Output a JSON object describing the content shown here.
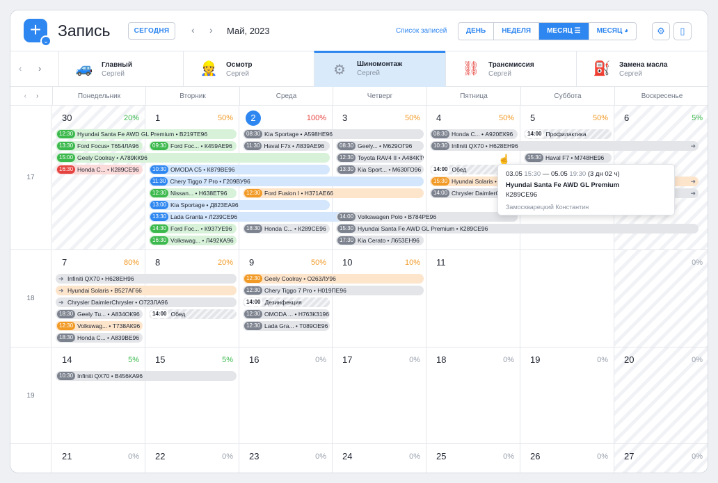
{
  "header": {
    "title": "Запись",
    "today_label": "СЕГОДНЯ",
    "period": "Май, 2023",
    "list_link": "Список записей",
    "views": [
      "ДЕНЬ",
      "НЕДЕЛЯ",
      "МЕСЯЦ",
      "МЕСЯЦ"
    ],
    "active_view": 2
  },
  "posts": [
    {
      "name": "Главный",
      "user": "Сергей",
      "icon": "car-icon"
    },
    {
      "name": "Осмотр",
      "user": "Сергей",
      "icon": "mechanic-icon"
    },
    {
      "name": "Шиномонтаж",
      "user": "Сергей",
      "icon": "wheel-icon",
      "active": true
    },
    {
      "name": "Трансмиссия",
      "user": "Сергей",
      "icon": "gearbox-icon"
    },
    {
      "name": "Замена масла",
      "user": "Сергей",
      "icon": "oil-can-icon"
    }
  ],
  "weekdays": [
    "Понедельник",
    "Вторник",
    "Среда",
    "Четверг",
    "Пятница",
    "Суббота",
    "Воскресенье"
  ],
  "weeks": [
    {
      "num": "17",
      "days": [
        {
          "d": "30",
          "p": "20%",
          "c": "#3cb94d",
          "hatch": true
        },
        {
          "d": "1",
          "p": "50%",
          "c": "#f19a26"
        },
        {
          "d": "2",
          "p": "100%",
          "c": "#e5433f",
          "today": true
        },
        {
          "d": "3",
          "p": "50%",
          "c": "#f19a26"
        },
        {
          "d": "4",
          "p": "50%",
          "c": "#f19a26"
        },
        {
          "d": "5",
          "p": "50%",
          "c": "#f19a26"
        },
        {
          "d": "6",
          "p": "5%",
          "c": "#3cb94d",
          "hatch": true
        }
      ]
    },
    {
      "num": "18",
      "days": [
        {
          "d": "7",
          "p": "80%",
          "c": "#f19a26"
        },
        {
          "d": "8",
          "p": "20%",
          "c": "#f19a26"
        },
        {
          "d": "9",
          "p": "50%",
          "c": "#f19a26"
        },
        {
          "d": "10",
          "p": "10%",
          "c": "#f19a26"
        },
        {
          "d": "11",
          "p": "",
          "c": "#9aa1ad"
        },
        {
          "d": "",
          "p": "",
          "c": "#9aa1ad"
        },
        {
          "d": "",
          "p": "0%",
          "c": "#9aa1ad",
          "hatch": true
        }
      ]
    },
    {
      "num": "19",
      "days": [
        {
          "d": "14",
          "p": "5%",
          "c": "#3cb94d"
        },
        {
          "d": "15",
          "p": "5%",
          "c": "#3cb94d"
        },
        {
          "d": "16",
          "p": "0%",
          "c": "#9aa1ad"
        },
        {
          "d": "17",
          "p": "0%",
          "c": "#9aa1ad"
        },
        {
          "d": "18",
          "p": "0%",
          "c": "#9aa1ad"
        },
        {
          "d": "19",
          "p": "0%",
          "c": "#9aa1ad"
        },
        {
          "d": "20",
          "p": "0%",
          "c": "#9aa1ad",
          "hatch": true
        }
      ]
    },
    {
      "num": "",
      "days": [
        {
          "d": "21",
          "p": "0%",
          "c": "#9aa1ad"
        },
        {
          "d": "22",
          "p": "0%",
          "c": "#9aa1ad"
        },
        {
          "d": "23",
          "p": "0%",
          "c": "#9aa1ad"
        },
        {
          "d": "24",
          "p": "0%",
          "c": "#9aa1ad"
        },
        {
          "d": "25",
          "p": "0%",
          "c": "#9aa1ad"
        },
        {
          "d": "26",
          "p": "0%",
          "c": "#9aa1ad"
        },
        {
          "d": "27",
          "p": "0%",
          "c": "#9aa1ad",
          "hatch": true
        }
      ]
    }
  ],
  "events": [
    {
      "w": 0,
      "s": 0,
      "e": 2,
      "r": 0,
      "t": "12:30",
      "x": "Hyundai Santa Fe AWD GL Premium • В219ТЕ96",
      "c": "green"
    },
    {
      "w": 0,
      "s": 0,
      "e": 1,
      "r": 1,
      "t": "13:30",
      "x": "Ford Focus• Т654ЛА96",
      "c": "green"
    },
    {
      "w": 0,
      "s": 0,
      "e": 3,
      "r": 2,
      "t": "15:00",
      "x": "Geely Coolray • А789КК96",
      "c": "green"
    },
    {
      "w": 0,
      "s": 0,
      "e": 1,
      "r": 3,
      "t": "16:30",
      "x": "Honda C... • К289СЕ96",
      "c": "red"
    },
    {
      "w": 0,
      "s": 1,
      "e": 2,
      "r": 1,
      "t": "09:30",
      "x": "Ford Foc... • К459АЕ96",
      "c": "green"
    },
    {
      "w": 0,
      "s": 1,
      "e": 3,
      "r": 3,
      "t": "10:30",
      "x": "OMODA C5 • К879ВЕ96",
      "c": "blue"
    },
    {
      "w": 0,
      "s": 1,
      "e": 4,
      "r": 4,
      "t": "11:30",
      "x": "Chery Tiggo 7 Pro • Г209ВУ96",
      "c": "blue"
    },
    {
      "w": 0,
      "s": 1,
      "e": 2,
      "r": 5,
      "t": "12:30",
      "x": "Nissan... • Н638ЕТ96",
      "c": "green"
    },
    {
      "w": 0,
      "s": 1,
      "e": 3,
      "r": 6,
      "t": "13:00",
      "x": "Kia Sportage • Д823ЕА96",
      "c": "blue"
    },
    {
      "w": 0,
      "s": 1,
      "e": 5,
      "r": 7,
      "t": "13:30",
      "x": "Lada Granta • Л239СЕ96",
      "c": "blue"
    },
    {
      "w": 0,
      "s": 1,
      "e": 2,
      "r": 8,
      "t": "14:30",
      "x": "Ford Foc... • К937УЕ96",
      "c": "green"
    },
    {
      "w": 0,
      "s": 1,
      "e": 2,
      "r": 9,
      "t": "16:30",
      "x": "Volkswag... • Л492КА96",
      "c": "green"
    },
    {
      "w": 0,
      "s": 2,
      "e": 4,
      "r": 0,
      "t": "08:30",
      "x": "Kia Sportage • А598НЕ96",
      "c": "gray"
    },
    {
      "w": 0,
      "s": 2,
      "e": 3,
      "r": 1,
      "t": "11:30",
      "x": "Haval F7x • Л839АЕ96",
      "c": "gray"
    },
    {
      "w": 0,
      "s": 2,
      "e": 4,
      "r": 5,
      "t": "12:30",
      "x": "Ford Fusion I • Н371АЕ66",
      "c": "orange"
    },
    {
      "w": 0,
      "s": 2,
      "e": 3,
      "r": 8,
      "t": "18:30",
      "x": "Honda C... • К289СЕ96",
      "c": "gray"
    },
    {
      "w": 0,
      "s": 3,
      "e": 4,
      "r": 1,
      "t": "08:30",
      "x": "Geely... • М629ОГ96",
      "c": "gray"
    },
    {
      "w": 0,
      "s": 3,
      "e": 4,
      "r": 2,
      "t": "12:30",
      "x": "Toyota RAV4 II • А484КТ96",
      "c": "gray"
    },
    {
      "w": 0,
      "s": 3,
      "e": 4,
      "r": 3,
      "t": "13:30",
      "x": "Kia Sport... • М630ГО96",
      "c": "gray"
    },
    {
      "w": 0,
      "s": 3,
      "e": 5,
      "r": 7,
      "t": "14:00",
      "x": "Volkswagen Polo • В784РЕ96",
      "c": "gray"
    },
    {
      "w": 0,
      "s": 3,
      "e": 7,
      "r": 8,
      "t": "15:30",
      "x": "Hyundai Santa Fe AWD GL Premium • К289СЕ96",
      "c": "gray"
    },
    {
      "w": 0,
      "s": 3,
      "e": 4,
      "r": 9,
      "t": "17:30",
      "x": "Kia Cerato • Л653ЕН96",
      "c": "gray"
    },
    {
      "w": 0,
      "s": 4,
      "e": 5,
      "r": 0,
      "t": "08:30",
      "x": "Honda C... • А920ЕК96",
      "c": "gray"
    },
    {
      "w": 0,
      "s": 4,
      "e": 7,
      "r": 1,
      "t": "10:30",
      "x": "Infiniti QX70 • Н628ЕН96",
      "c": "gray",
      "ra": "➜"
    },
    {
      "w": 0,
      "s": 4,
      "e": 5,
      "r": 3,
      "t": "14:00",
      "x": "Обед",
      "c": "gray",
      "hatch": true
    },
    {
      "w": 0,
      "s": 4,
      "e": 8,
      "r": 4,
      "t": "15:30",
      "x": "Hyundai Solaris • В527АГ66",
      "c": "orange",
      "ra": "➜"
    },
    {
      "w": 0,
      "s": 4,
      "e": 7,
      "r": 5,
      "t": "14:00",
      "x": "Chrysler DaimlerChrysler • О723ЛА96",
      "c": "gray",
      "ra": "➜"
    },
    {
      "w": 0,
      "s": 5,
      "e": 6,
      "r": 0,
      "t": "14:00",
      "x": "Профилактика",
      "c": "gray",
      "hatch": true
    },
    {
      "w": 0,
      "s": 5,
      "e": 6,
      "r": 2,
      "t": "15:30",
      "x": "Haval F7 • М748НЕ96",
      "c": "gray"
    },
    {
      "w": 1,
      "s": 0,
      "e": 2,
      "r": 0,
      "t": "",
      "a": "➜",
      "x": "Infiniti QX70 • Н628ЕН96",
      "c": "gray"
    },
    {
      "w": 1,
      "s": 0,
      "e": 2,
      "r": 1,
      "t": "",
      "a": "➜",
      "x": "Hyundai Solaris • В527АГ66",
      "c": "orange"
    },
    {
      "w": 1,
      "s": 0,
      "e": 2,
      "r": 2,
      "t": "",
      "a": "➜",
      "x": "Chrysler DaimlerChrysler • О723ЛА96",
      "c": "gray"
    },
    {
      "w": 1,
      "s": 0,
      "e": 1,
      "r": 3,
      "t": "18:30",
      "x": "Geely Tu... • А834ОК96",
      "c": "gray"
    },
    {
      "w": 1,
      "s": 0,
      "e": 1,
      "r": 4,
      "t": "12:30",
      "x": "Volkswag... • Т738АК96",
      "c": "orange"
    },
    {
      "w": 1,
      "s": 0,
      "e": 1,
      "r": 5,
      "t": "18:30",
      "x": "Honda C... • А839ВЕ96",
      "c": "gray"
    },
    {
      "w": 1,
      "s": 1,
      "e": 2,
      "r": 3,
      "t": "14:00",
      "x": "Обед",
      "c": "gray",
      "hatch": true
    },
    {
      "w": 1,
      "s": 2,
      "e": 4,
      "r": 0,
      "t": "12:30",
      "x": "Geely Coolray • О263ЛУ96",
      "c": "orange"
    },
    {
      "w": 1,
      "s": 2,
      "e": 4,
      "r": 1,
      "t": "12:30",
      "x": "Chery Tiggo 7 Pro • Н019ПЕ96",
      "c": "gray"
    },
    {
      "w": 1,
      "s": 2,
      "e": 3,
      "r": 2,
      "t": "14:00",
      "x": "Дезинфекция",
      "c": "gray",
      "hatch": true
    },
    {
      "w": 1,
      "s": 2,
      "e": 3,
      "r": 3,
      "t": "12:30",
      "x": "OMODA ... • Н763К3196",
      "c": "gray"
    },
    {
      "w": 1,
      "s": 2,
      "e": 3,
      "r": 4,
      "t": "12:30",
      "x": "Lada Gra... • Т089ОЕ96",
      "c": "gray"
    },
    {
      "w": 2,
      "s": 0,
      "e": 2,
      "r": 0,
      "t": "10:30",
      "x": "Infiniti QX70 • В456КА96",
      "c": "gray"
    }
  ],
  "tooltip": {
    "start_date": "03.05",
    "start_time": "15:30",
    "dash": "—",
    "end_date": "05.05",
    "end_time": "19:30",
    "duration": "(3 дн 02 ч)",
    "car": "Hyundai Santa Fe AWD GL Premium",
    "plate": "К289СЕ96",
    "person": "Замоскварецкий Константин"
  }
}
